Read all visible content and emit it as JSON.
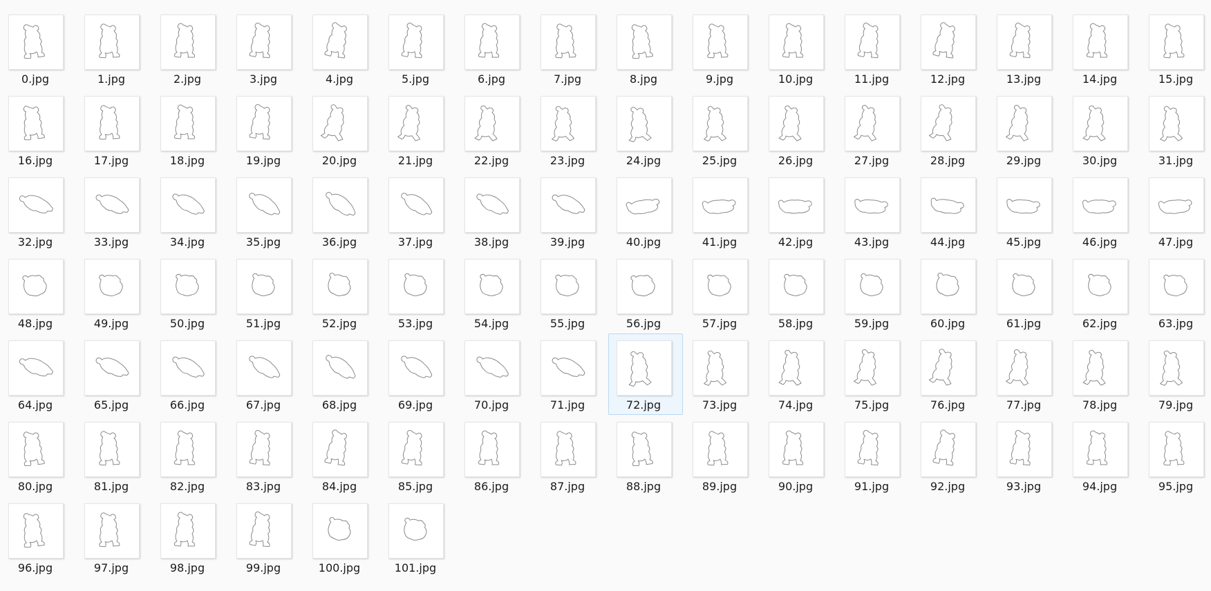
{
  "window": {
    "background": "#fafafa"
  },
  "files": [
    "0.jpg",
    "1.jpg",
    "2.jpg",
    "3.jpg",
    "4.jpg",
    "5.jpg",
    "6.jpg",
    "7.jpg",
    "8.jpg",
    "9.jpg",
    "10.jpg",
    "11.jpg",
    "12.jpg",
    "13.jpg",
    "14.jpg",
    "15.jpg",
    "16.jpg",
    "17.jpg",
    "18.jpg",
    "19.jpg",
    "20.jpg",
    "21.jpg",
    "22.jpg",
    "23.jpg",
    "24.jpg",
    "25.jpg",
    "26.jpg",
    "27.jpg",
    "28.jpg",
    "29.jpg",
    "30.jpg",
    "31.jpg",
    "32.jpg",
    "33.jpg",
    "34.jpg",
    "35.jpg",
    "36.jpg",
    "37.jpg",
    "38.jpg",
    "39.jpg",
    "40.jpg",
    "41.jpg",
    "42.jpg",
    "43.jpg",
    "44.jpg",
    "45.jpg",
    "46.jpg",
    "47.jpg",
    "48.jpg",
    "49.jpg",
    "50.jpg",
    "51.jpg",
    "52.jpg",
    "53.jpg",
    "54.jpg",
    "55.jpg",
    "56.jpg",
    "57.jpg",
    "58.jpg",
    "59.jpg",
    "60.jpg",
    "61.jpg",
    "62.jpg",
    "63.jpg",
    "64.jpg",
    "65.jpg",
    "66.jpg",
    "67.jpg",
    "68.jpg",
    "69.jpg",
    "70.jpg",
    "71.jpg",
    "72.jpg",
    "73.jpg",
    "74.jpg",
    "75.jpg",
    "76.jpg",
    "77.jpg",
    "78.jpg",
    "79.jpg",
    "80.jpg",
    "81.jpg",
    "82.jpg",
    "83.jpg",
    "84.jpg",
    "85.jpg",
    "86.jpg",
    "87.jpg",
    "88.jpg",
    "89.jpg",
    "90.jpg",
    "91.jpg",
    "92.jpg",
    "93.jpg",
    "94.jpg",
    "95.jpg",
    "96.jpg",
    "97.jpg",
    "98.jpg",
    "99.jpg",
    "100.jpg",
    "101.jpg"
  ],
  "selected_file": "72.jpg",
  "thumbnail_icon": "teddy-bear-outline-icon",
  "colors": {
    "selection_fill": "#eef6fd",
    "selection_border": "#b9d8f3",
    "outline": "#8a8a8a"
  }
}
